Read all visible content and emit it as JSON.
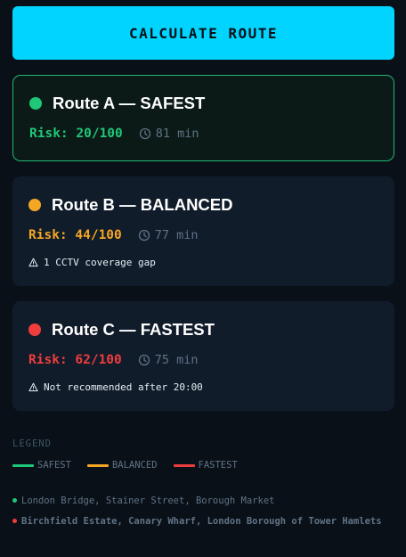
{
  "action": {
    "calculate_label": "CALCULATE ROUTE"
  },
  "routes": [
    {
      "title": "Route A — SAFEST",
      "risk": "Risk: 20/100",
      "time": "81 min",
      "warning": "",
      "color": "#1ec878"
    },
    {
      "title": "Route B — BALANCED",
      "risk": "Risk: 44/100",
      "time": "77 min",
      "warning": "1 CCTV coverage gap",
      "color": "#f5a623"
    },
    {
      "title": "Route C — FASTEST",
      "risk": "Risk: 62/100",
      "time": "75 min",
      "warning": "Not recommended after 20:00",
      "color": "#ef3d3d"
    }
  ],
  "legend": {
    "title": "LEGEND",
    "items": [
      {
        "label": "SAFEST",
        "color": "#1ec878"
      },
      {
        "label": "BALANCED",
        "color": "#f5a623"
      },
      {
        "label": "FASTEST",
        "color": "#ef3d3d"
      }
    ]
  },
  "areas": {
    "safe": "London Bridge, Stainer Street, Borough Market",
    "risk": "Birchfield Estate, Canary Wharf, London Borough of Tower Hamlets"
  },
  "icons": {
    "clock": "clock-icon",
    "warning": "warning-icon"
  }
}
